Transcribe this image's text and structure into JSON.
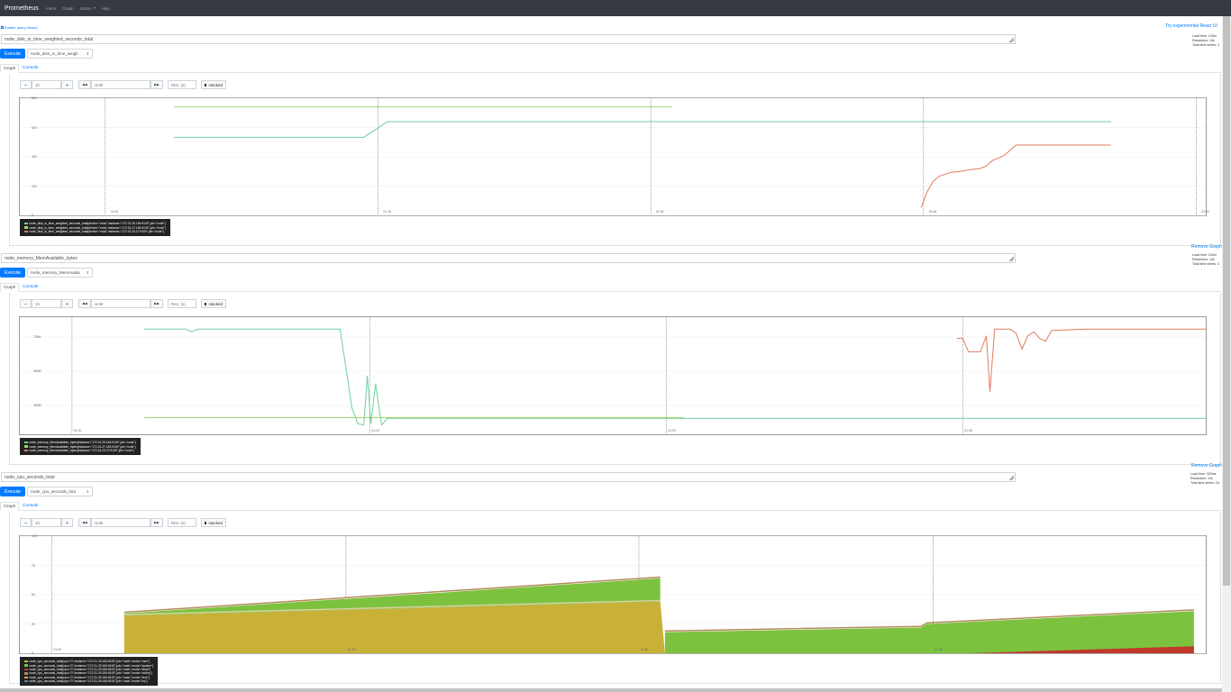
{
  "navbar": {
    "brand": "Prometheus",
    "links": [
      "Alerts",
      "Graph",
      "Status",
      "Help"
    ]
  },
  "query_history_label": "Enable query history",
  "top_links": {
    "experiments": "Try experimental React UI"
  },
  "panels": [
    {
      "expression": "node_disk_io_time_weighted_seconds_total",
      "metric_select": "node_disk_io_time_weigh",
      "execute": "Execute",
      "stats": [
        "Load time: 126m",
        "Resolution: 14s",
        "Total time series: 3"
      ],
      "remove_link": "",
      "tabs": {
        "graph": "Graph",
        "console": "Console"
      },
      "controls": {
        "range": "1h",
        "until": "Until",
        "res": "Res. (s)",
        "stacked": "stacked",
        "minus": "−",
        "plus": "+",
        "back": "◀◀",
        "fwd": "▶▶"
      },
      "y_ticks": [
        "800",
        "600",
        "400",
        "200",
        "0"
      ],
      "x_ticks": [
        "01:00",
        "01:15",
        "01:30",
        "01:45",
        "02:00"
      ],
      "legend": [
        {
          "label": "node_disk_io_time_weighted_seconds_total{device=\"xvda\",instance=\"172.31.29.184:9100\",job=\"node\"}",
          "color": "#6fcfa0"
        },
        {
          "label": "node_disk_io_time_weighted_seconds_total{device=\"xvda\",instance=\"172.31.27.184:9100\",job=\"node\"}",
          "color": "#9fd66d"
        },
        {
          "label": "node_disk_io_time_weighted_seconds_total{device=\"xvda\",instance=\"172.31.23.27:9100\",job=\"node\"}",
          "color": "#e07a5f"
        }
      ]
    },
    {
      "expression": "node_memory_MemAvailable_bytes",
      "metric_select": "node_memory_MemAvaila",
      "execute": "Execute",
      "stats": [
        "Load time: 100m",
        "Resolution: 14s",
        "Total time series: 3"
      ],
      "remove_link": "Remove Graph",
      "tabs": {
        "graph": "Graph",
        "console": "Console"
      },
      "controls": {
        "range": "1h",
        "until": "Until",
        "res": "Res. (s)",
        "stacked": "stacked",
        "minus": "−",
        "plus": "+",
        "back": "◀◀",
        "fwd": "▶▶"
      },
      "y_ticks": [
        "750M",
        "500M",
        "250M"
      ],
      "x_ticks": [
        "01:00",
        "01:15",
        "01:30",
        "01:45"
      ],
      "legend": [
        {
          "label": "node_memory_MemAvailable_bytes{instance=\"172.31.29.184:9100\",job=\"node\"}",
          "color": "#6fcfa0"
        },
        {
          "label": "node_memory_MemAvailable_bytes{instance=\"172.31.27.184:9100\",job=\"node\"}",
          "color": "#9fd66d"
        },
        {
          "label": "node_memory_MemAvailable_bytes{instance=\"172.31.23.27:9100\",job=\"node\"}",
          "color": "#e07a5f"
        }
      ]
    },
    {
      "expression": "node_cpu_seconds_total",
      "metric_select": "node_cpu_seconds_tota",
      "execute": "Execute",
      "stats": [
        "Load time: 333ms",
        "Resolution: 14s",
        "Total time series: 24"
      ],
      "remove_link": "Remove Graph",
      "tabs": {
        "graph": "Graph",
        "console": "Console"
      },
      "controls": {
        "range": "1h",
        "until": "Until",
        "res": "Res. (s)",
        "stacked": "stacked",
        "minus": "−",
        "plus": "+",
        "back": "◀◀",
        "fwd": "▶▶"
      },
      "y_ticks": [
        "100",
        "75",
        "50",
        "25",
        "0"
      ],
      "x_ticks": [
        "01:00",
        "01:15",
        "01:30",
        "01:45"
      ],
      "legend": [
        {
          "label": "node_cpu_seconds_total{cpu=\"0\",instance=\"172.31.29.184:9100\",job=\"node\",mode=\"user\"}",
          "color": "#c9b037"
        },
        {
          "label": "node_cpu_seconds_total{cpu=\"0\",instance=\"172.31.29.184:9100\",job=\"node\",mode=\"system\"}",
          "color": "#7cc23f"
        },
        {
          "label": "node_cpu_seconds_total{cpu=\"0\",instance=\"172.31.29.184:9100\",job=\"node\",mode=\"steal\"}",
          "color": "#c0392b"
        },
        {
          "label": "node_cpu_seconds_total{cpu=\"0\",instance=\"172.31.29.184:9100\",job=\"node\",mode=\"softirq\"}",
          "color": "#b38b5d"
        },
        {
          "label": "node_cpu_seconds_total{cpu=\"0\",instance=\"172.31.29.184:9100\",job=\"node\",mode=\"nice\"}",
          "color": "#d4a373"
        },
        {
          "label": "node_cpu_seconds_total{cpu=\"0\",instance=\"172.31.29.184:9100\",job=\"node\",mode=\"irq\"}",
          "color": "#5b7db1"
        }
      ]
    }
  ],
  "chart_data": [
    {
      "type": "line",
      "ylim": [
        0,
        900
      ],
      "series": [
        {
          "name": "node_disk_io_time_weighted_seconds_total{device=\"xvda\",instance=\"172.31.29.184:9100\",job=\"node\"}",
          "color": "#6fcfa0",
          "points": [
            [
              0.13,
              600
            ],
            [
              0.29,
              600
            ],
            [
              0.305,
              690
            ],
            [
              0.31,
              720
            ],
            [
              0.92,
              720
            ]
          ]
        },
        {
          "name": "node_disk_io_time_weighted_seconds_total{device=\"xvda\",instance=\"172.31.27.184:9100\",job=\"node\"}",
          "color": "#9fd66d",
          "points": [
            [
              0.13,
              833
            ],
            [
              0.55,
              833
            ]
          ]
        },
        {
          "name": "node_disk_io_time_weighted_seconds_total{device=\"xvda\",instance=\"172.31.23.27:9100\",job=\"node\"}",
          "color": "#e07a5f",
          "points": [
            [
              0.76,
              60
            ],
            [
              0.765,
              180
            ],
            [
              0.77,
              260
            ],
            [
              0.775,
              300
            ],
            [
              0.785,
              330
            ],
            [
              0.795,
              340
            ],
            [
              0.8,
              350
            ],
            [
              0.81,
              360
            ],
            [
              0.815,
              380
            ],
            [
              0.82,
              420
            ],
            [
              0.825,
              440
            ],
            [
              0.83,
              460
            ],
            [
              0.835,
              500
            ],
            [
              0.84,
              540
            ],
            [
              0.92,
              540
            ]
          ]
        }
      ]
    },
    {
      "type": "line",
      "ylim": [
        0,
        880
      ],
      "series": [
        {
          "name": "node_memory_MemAvailable_bytes{instance=\"172.31.29.184:9100\",job=\"node\"}",
          "color": "#6fcfa0",
          "points": [
            [
              0.105,
              790
            ],
            [
              0.14,
              790
            ],
            [
              0.145,
              770
            ],
            [
              0.15,
              790
            ],
            [
              0.2,
              790
            ],
            [
              0.27,
              790
            ],
            [
              0.275,
              500
            ],
            [
              0.28,
              200
            ],
            [
              0.285,
              80
            ],
            [
              0.29,
              70
            ],
            [
              0.293,
              440
            ],
            [
              0.296,
              80
            ],
            [
              0.3,
              380
            ],
            [
              0.305,
              70
            ],
            [
              0.31,
              120
            ],
            [
              0.5,
              120
            ],
            [
              1.0,
              120
            ]
          ]
        },
        {
          "name": "node_memory_MemAvailable_bytes{instance=\"172.31.27.184:9100\",job=\"node\"}",
          "color": "#9fd66d",
          "points": [
            [
              0.105,
              125
            ],
            [
              0.56,
              125
            ]
          ]
        },
        {
          "name": "node_memory_MemAvailable_bytes{instance=\"172.31.23.27:9100\",job=\"node\"}",
          "color": "#e07a5f",
          "points": [
            [
              0.79,
              720
            ],
            [
              0.795,
              720
            ],
            [
              0.8,
              620
            ],
            [
              0.81,
              620
            ],
            [
              0.815,
              740
            ],
            [
              0.818,
              320
            ],
            [
              0.822,
              790
            ],
            [
              0.835,
              790
            ],
            [
              0.84,
              760
            ],
            [
              0.845,
              640
            ],
            [
              0.85,
              740
            ],
            [
              0.855,
              770
            ],
            [
              0.86,
              720
            ],
            [
              0.865,
              700
            ],
            [
              0.87,
              780
            ],
            [
              0.9,
              790
            ],
            [
              1.0,
              790
            ]
          ]
        }
      ]
    },
    {
      "type": "area",
      "stacked": true,
      "ylim": [
        0,
        100
      ],
      "series": [
        {
          "name": "node_cpu_seconds_total{cpu=\"0\",instance=\"172.31.29.184:9100\",job=\"node\",mode=\"user\"}",
          "color": "#c9b037",
          "points": [
            [
              0.088,
              32
            ],
            [
              0.54,
              44
            ],
            [
              0.544,
              0
            ],
            [
              1.0,
              0
            ]
          ]
        },
        {
          "name": "node_cpu_seconds_total{cpu=\"0\",instance=\"172.31.29.184:9100\",job=\"node\",mode=\"system\"}",
          "color": "#7cc23f",
          "points": [
            [
              0.088,
              2
            ],
            [
              0.54,
              20
            ],
            [
              0.544,
              18
            ],
            [
              0.76,
              22
            ],
            [
              0.765,
              25
            ],
            [
              0.99,
              36
            ]
          ]
        },
        {
          "name": "node_cpu_seconds_total{cpu=\"0\",instance=\"172.31.29.184:9100\",job=\"node\",mode=\"steal\"}",
          "color": "#c0392b",
          "points": [
            [
              0.088,
              0
            ],
            [
              0.8,
              0
            ],
            [
              0.99,
              6
            ]
          ]
        }
      ]
    }
  ]
}
